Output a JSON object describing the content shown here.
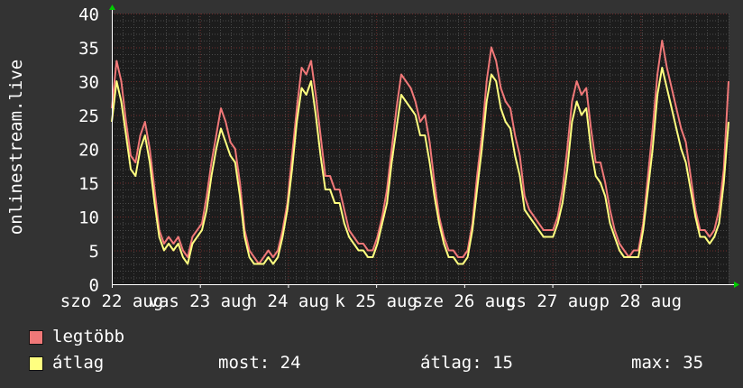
{
  "chart_data": {
    "type": "line",
    "ylabel": "onlinestream.live",
    "ylim": [
      0,
      40
    ],
    "y_ticks": [
      0,
      5,
      10,
      15,
      20,
      25,
      30,
      35,
      40
    ],
    "x_tick_labels": [
      "szo 22 aug",
      "vas 23 aug",
      "h 24 aug",
      "k 25 aug",
      "sze 26 aug",
      "cs 27 aug",
      "p 28 aug"
    ],
    "grid": true,
    "colors": {
      "background": "#333333",
      "plot_bg": "#1c1c1c",
      "grid_major": "#6e2b2b",
      "grid_minor": "#4a4a4a",
      "axis": "#ffffff",
      "arrow": "#00cc00"
    },
    "series": [
      {
        "name": "legtöbb",
        "color": "#f07878",
        "values": [
          26,
          33,
          30,
          24,
          19,
          18,
          22,
          24,
          20,
          14,
          8,
          6,
          7,
          6,
          7,
          5,
          4,
          7,
          8,
          9,
          13,
          18,
          22,
          26,
          24,
          21,
          20,
          15,
          8,
          5,
          4,
          3,
          4,
          5,
          4,
          5,
          8,
          12,
          19,
          26,
          32,
          31,
          33,
          28,
          22,
          16,
          16,
          14,
          14,
          11,
          8,
          7,
          6,
          6,
          5,
          5,
          7,
          10,
          14,
          20,
          26,
          31,
          30,
          29,
          27,
          24,
          25,
          21,
          15,
          10,
          7,
          5,
          5,
          4,
          4,
          5,
          9,
          16,
          22,
          30,
          35,
          33,
          29,
          27,
          26,
          22,
          19,
          13,
          11,
          10,
          9,
          8,
          8,
          8,
          10,
          14,
          20,
          27,
          30,
          28,
          29,
          23,
          18,
          18,
          15,
          11,
          8,
          6,
          5,
          4,
          5,
          5,
          9,
          16,
          23,
          31,
          36,
          32,
          29,
          26,
          23,
          21,
          16,
          11,
          8,
          8,
          7,
          8,
          11,
          17,
          30
        ]
      },
      {
        "name": "átlag",
        "color": "#ffff80",
        "values": [
          24,
          30,
          27,
          22,
          17,
          16,
          20,
          22,
          18,
          12,
          7,
          5,
          6,
          5,
          6,
          4,
          3,
          6,
          7,
          8,
          11,
          16,
          20,
          23,
          21,
          19,
          18,
          13,
          7,
          4,
          3,
          3,
          3,
          4,
          3,
          4,
          7,
          11,
          17,
          24,
          29,
          28,
          30,
          25,
          19,
          14,
          14,
          12,
          12,
          9,
          7,
          6,
          5,
          5,
          4,
          4,
          6,
          9,
          12,
          18,
          23,
          28,
          27,
          26,
          25,
          22,
          22,
          18,
          13,
          9,
          6,
          4,
          4,
          3,
          3,
          4,
          8,
          14,
          20,
          27,
          31,
          30,
          26,
          24,
          23,
          19,
          16,
          11,
          10,
          9,
          8,
          7,
          7,
          7,
          9,
          12,
          17,
          24,
          27,
          25,
          26,
          20,
          16,
          15,
          13,
          9,
          7,
          5,
          4,
          4,
          4,
          4,
          8,
          14,
          20,
          28,
          32,
          29,
          26,
          23,
          20,
          18,
          14,
          10,
          7,
          7,
          6,
          7,
          9,
          15,
          24
        ]
      }
    ]
  },
  "legend": [
    {
      "label": "legtöbb",
      "color": "#f07878"
    },
    {
      "label": "átlag",
      "color": "#ffff80"
    }
  ],
  "stats": {
    "most": "most: 24",
    "atlag": "átlag: 15",
    "max": "max: 35"
  }
}
